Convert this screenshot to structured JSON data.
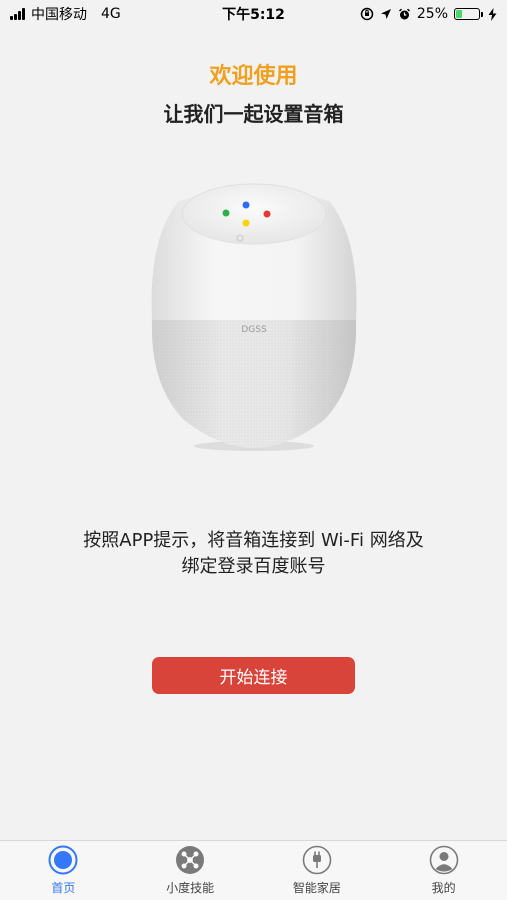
{
  "status_bar": {
    "carrier": "中国移动",
    "network": "4G",
    "time": "下午5:12",
    "battery_percent": "25%",
    "battery_level": 0.25,
    "icons": [
      "signal-icon",
      "orientation-lock-icon",
      "location-icon",
      "alarm-icon",
      "battery-icon",
      "charging-icon"
    ]
  },
  "header": {
    "welcome": "欢迎使用",
    "subtitle": "让我们一起设置音箱"
  },
  "speaker": {
    "logo_text": "DGSS",
    "led_colors": [
      "#2e6bf5",
      "#2bb24c",
      "#e53935",
      "#f5d400"
    ]
  },
  "description": {
    "line1": "按照APP提示，将音箱连接到 Wi-Fi 网络及",
    "line2": "绑定登录百度账号"
  },
  "start_button": {
    "label": "开始连接",
    "color": "#d9443a"
  },
  "tab_bar": {
    "tabs": [
      {
        "label": "首页",
        "icon": "home-icon",
        "active": true
      },
      {
        "label": "小度技能",
        "icon": "skills-icon",
        "active": false
      },
      {
        "label": "智能家居",
        "icon": "plug-icon",
        "active": false
      },
      {
        "label": "我的",
        "icon": "profile-icon",
        "active": false
      }
    ],
    "active_color": "#3478f6"
  }
}
